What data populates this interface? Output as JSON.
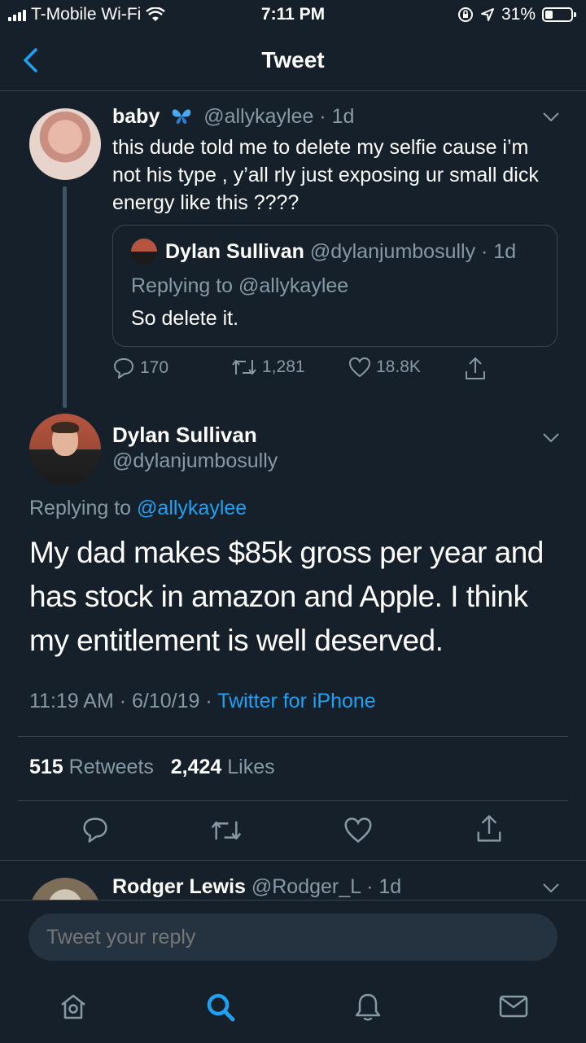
{
  "status_bar": {
    "carrier": "T-Mobile Wi-Fi",
    "time": "7:11 PM",
    "battery_pct": "31%",
    "battery_level": 0.31
  },
  "header": {
    "title": "Tweet"
  },
  "quoted_thread": {
    "name": "baby",
    "handle": "@allykaylee",
    "age": "· 1d",
    "text": "this dude told me to delete my selfie cause i’m not his type , y’all rly just exposing ur small dick energy like this ????",
    "quote": {
      "name": "Dylan Sullivan",
      "handle": "@dylanjumbosully · 1d",
      "replying": "Replying to @allykaylee",
      "text": "So delete it."
    },
    "stats": {
      "replies": "170",
      "retweets": "1,281",
      "likes": "18.8K"
    }
  },
  "main_tweet": {
    "name": "Dylan Sullivan",
    "handle": "@dylanjumbosully",
    "replying_prefix": "Replying to",
    "replying_handle": "@allykaylee",
    "text": "My dad makes $85k gross per year and has stock in amazon and Apple. I think my entitlement is well deserved.",
    "time": "11:19 AM · 6/10/19 ·",
    "source": "Twitter for iPhone",
    "retweet_count": "515",
    "retweet_label": "Retweets",
    "like_count": "2,424",
    "like_label": "Likes"
  },
  "next_reply": {
    "name": "Rodger Lewis",
    "handle": "@Rodger_L · 1d"
  },
  "composer": {
    "placeholder": "Tweet your reply"
  },
  "colors": {
    "background": "#15202b",
    "accent": "#1da1f2",
    "muted": "#8899a6",
    "divider": "#38444d"
  },
  "icons": [
    "back-icon",
    "chevron-down-icon",
    "reply-icon",
    "retweet-icon",
    "like-icon",
    "share-icon",
    "home-icon",
    "search-icon",
    "notifications-icon",
    "messages-icon"
  ]
}
